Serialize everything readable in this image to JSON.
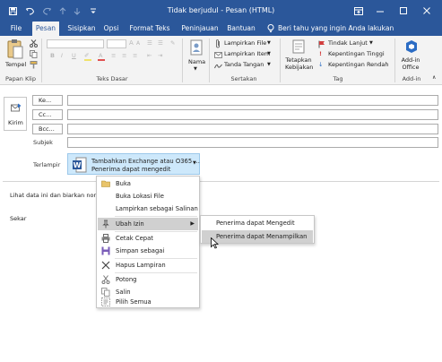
{
  "window": {
    "title": "Tidak berjudul - Pesan (HTML)",
    "quick_access": [
      "save-icon",
      "undo-icon",
      "redo-icon",
      "up-arrow-icon",
      "down-arrow-icon",
      "customize-icon"
    ],
    "controls": [
      "ribbon-display-icon",
      "minimize-icon",
      "maximize-icon",
      "close-icon"
    ]
  },
  "tabs": [
    {
      "label": "File"
    },
    {
      "label": "Pesan"
    },
    {
      "label": "Sisipkan"
    },
    {
      "label": "Opsi"
    },
    {
      "label": "Format Teks"
    },
    {
      "label": "Peninjauan"
    },
    {
      "label": "Bantuan"
    }
  ],
  "active_tab": "Pesan",
  "tell_me": "Beri tahu yang ingin Anda lakukan",
  "ribbon": {
    "clipboard": {
      "paste_label": "Tempel",
      "group_label": "Papan Klip"
    },
    "basic_text": {
      "group_label": "Teks Dasar",
      "font_buttons": [
        "B",
        "I",
        "U"
      ]
    },
    "names": {
      "label": "Nama"
    },
    "include": {
      "group_label": "Sertakan",
      "items": [
        "Lampirkan File",
        "Lampirkan Item",
        "Tanda Tangan"
      ]
    },
    "tags": {
      "policy_label": "Tetapkan Kebijakan",
      "group_label": "Tag",
      "items": [
        "Tindak Lanjut",
        "Kepentingan Tinggi",
        "Kepentingan Rendah"
      ]
    },
    "addin": {
      "label": "Add-in Office",
      "group_label": "Add-in"
    }
  },
  "compose": {
    "send_label": "Kirim",
    "to_label": "Ke...",
    "cc_label": "Cc...",
    "bcc_label": "Bcc...",
    "subject_label": "Subjek",
    "attached_label": "Terlampir",
    "attachment": {
      "name": "Tambahkan Exchange atau O365 ...",
      "subtitle": "Penerima dapat mengedit"
    },
    "body_lines": [
      "Lihat data ini dan biarkan normal",
      "Sekar"
    ]
  },
  "context_menu": {
    "items": [
      {
        "label": "Buka",
        "icon": "open-folder-icon",
        "highlighted": false
      },
      {
        "label": "Buka Lokasi File",
        "icon": "",
        "highlighted": false
      },
      {
        "label": "Lampirkan sebagai Salinan",
        "icon": "",
        "highlighted": false
      },
      {
        "label": "Ubah Izin",
        "icon": "pin-icon",
        "highlighted": true,
        "submenu": true
      },
      {
        "label": "Cetak Cepat",
        "icon": "printer-icon",
        "highlighted": false
      },
      {
        "label": "Simpan sebagai",
        "icon": "save-as-icon",
        "highlighted": false
      },
      {
        "label": "Hapus Lampiran",
        "icon": "remove-icon",
        "highlighted": false
      },
      {
        "label": "Potong",
        "icon": "cut-icon",
        "highlighted": false
      },
      {
        "label": "Salin",
        "icon": "copy-icon",
        "highlighted": false
      },
      {
        "label": "Pilih Semua",
        "icon": "select-all-icon",
        "highlighted": false
      }
    ]
  },
  "submenu": {
    "items": [
      {
        "label": "Penerima dapat Mengedit",
        "highlighted": false
      },
      {
        "label": "Penerima dapat Menampilkan",
        "highlighted": true
      }
    ]
  },
  "colors": {
    "title_bar": "#2b579a",
    "ribbon": "#f3f3f3",
    "attachment": "#cde8fb",
    "menu_highlight": "#d0d0d0"
  }
}
